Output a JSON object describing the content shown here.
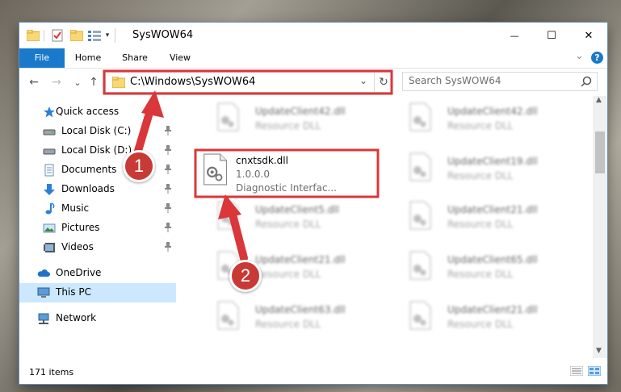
{
  "window": {
    "title": "SysWOW64",
    "controls": {
      "minimize": "—",
      "maximize": "☐",
      "close": "✕"
    },
    "help_label": "?",
    "expand_label": "⌄"
  },
  "ribbon": {
    "tabs": [
      "File",
      "Home",
      "Share",
      "View"
    ]
  },
  "navigation": {
    "back": "←",
    "forward": "→",
    "recent": "⌄",
    "up": "↑",
    "address": "C:\\Windows\\SysWOW64",
    "address_dropdown": "⌄",
    "refresh": "↻",
    "search_placeholder": "Search SysWOW64"
  },
  "sidebar": {
    "items": [
      {
        "label": "Quick access",
        "icon": "star-icon"
      },
      {
        "label": "Local Disk (C:)",
        "icon": "drive-icon",
        "pinned": true
      },
      {
        "label": "Local Disk (D:)",
        "icon": "drive-icon",
        "pinned": true
      },
      {
        "label": "Documents",
        "icon": "documents-icon",
        "pinned": true
      },
      {
        "label": "Downloads",
        "icon": "downloads-icon",
        "pinned": true
      },
      {
        "label": "Music",
        "icon": "music-icon",
        "pinned": true
      },
      {
        "label": "Pictures",
        "icon": "pictures-icon",
        "pinned": true
      },
      {
        "label": "Videos",
        "icon": "videos-icon",
        "pinned": true
      },
      {
        "label": "OneDrive",
        "icon": "cloud-icon"
      },
      {
        "label": "This PC",
        "icon": "computer-icon",
        "selected": true
      },
      {
        "label": "Network",
        "icon": "network-icon"
      }
    ]
  },
  "files": {
    "highlighted": {
      "name": "cnxtsdk.dll",
      "version": "1.0.0.0",
      "description": "Diagnostic Interfac..."
    },
    "others": [
      {
        "name": "UpdateClient42.dll",
        "type": "Resource DLL"
      },
      {
        "name": "UpdateClient42.dll",
        "type": "Resource DLL"
      },
      {
        "name": "UpdateClient19.dll",
        "type": "Resource DLL"
      },
      {
        "name": "UpdateClient5.dll",
        "type": "Resource DLL"
      },
      {
        "name": "UpdateClient21.dll",
        "type": "Resource DLL"
      },
      {
        "name": "UpdateClient21.dll",
        "type": "Resource DLL"
      },
      {
        "name": "UpdateClient65.dll",
        "type": "Resource DLL"
      },
      {
        "name": "UpdateClient63.dll",
        "type": "Resource DLL"
      },
      {
        "name": "UpdateClient21.dll",
        "type": "Resource DLL"
      }
    ]
  },
  "status": {
    "item_count": "171 items"
  },
  "annotations": {
    "step1": "1",
    "step2": "2",
    "color": "#d9373a"
  }
}
